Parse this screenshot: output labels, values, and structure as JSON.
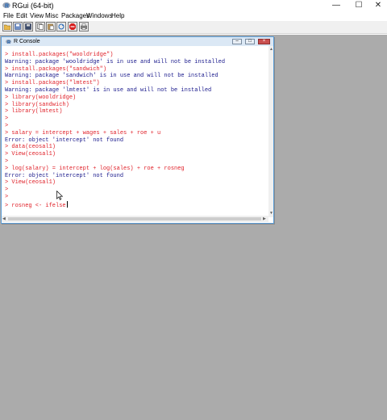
{
  "app": {
    "title": "RGui (64-bit)",
    "controls": {
      "minimize": "—",
      "maximize": "☐",
      "close": "✕"
    }
  },
  "menu": {
    "items": [
      {
        "label": "File",
        "id": "file"
      },
      {
        "label": "Edit",
        "id": "edit"
      },
      {
        "label": "View",
        "id": "view"
      },
      {
        "label": "Misc",
        "id": "misc"
      },
      {
        "label": "Packages",
        "id": "packages"
      },
      {
        "label": "Windows",
        "id": "windows"
      },
      {
        "label": "Help",
        "id": "help"
      }
    ]
  },
  "toolbar": {
    "buttons": [
      {
        "icon": "open-script-icon"
      },
      {
        "icon": "load-workspace-icon"
      },
      {
        "icon": "save-workspace-icon"
      },
      {
        "icon": "copy-icon"
      },
      {
        "icon": "paste-icon"
      },
      {
        "icon": "copy-paste-icon"
      },
      {
        "icon": "stop-icon"
      },
      {
        "icon": "print-icon"
      }
    ]
  },
  "console": {
    "title": "R Console",
    "controls": {
      "minimize": "–",
      "maximize": "□",
      "close": "×"
    },
    "lines": [
      {
        "type": "input",
        "text": "> install.packages(\"wooldridge\")"
      },
      {
        "type": "output",
        "text": "Warning: package 'wooldridge' is in use and will not be installed"
      },
      {
        "type": "input",
        "text": "> install.packages(\"sandwich\")"
      },
      {
        "type": "output",
        "text": "Warning: package 'sandwich' is in use and will not be installed"
      },
      {
        "type": "input",
        "text": "> install.packages(\"lmtest\")"
      },
      {
        "type": "output",
        "text": "Warning: package 'lmtest' is in use and will not be installed"
      },
      {
        "type": "input",
        "text": "> library(wooldridge)"
      },
      {
        "type": "input",
        "text": "> library(sandwich)"
      },
      {
        "type": "input",
        "text": "> library(lmtest)"
      },
      {
        "type": "input",
        "text": ">"
      },
      {
        "type": "input",
        "text": ">"
      },
      {
        "type": "input",
        "text": "> salary = intercept + wages + sales + roe + u"
      },
      {
        "type": "output",
        "text": "Error: object 'intercept' not found"
      },
      {
        "type": "input",
        "text": "> data(ceosal1)"
      },
      {
        "type": "input",
        "text": "> View(ceosal1)"
      },
      {
        "type": "input",
        "text": ">"
      },
      {
        "type": "input",
        "text": "> log(salary) = intercept + log(sales) + roe + rosneg"
      },
      {
        "type": "output",
        "text": "Error: object 'intercept' not found"
      },
      {
        "type": "input",
        "text": "> View(ceosal1)"
      },
      {
        "type": "input",
        "text": ">"
      },
      {
        "type": "input",
        "text": ">"
      },
      {
        "type": "input",
        "text": "> rosneg <- ifelse"
      }
    ]
  },
  "colors": {
    "input": "#e0222a",
    "output": "#1a1a8c",
    "mdi_background": "#ababab",
    "console_title": "#dbe8f5"
  }
}
